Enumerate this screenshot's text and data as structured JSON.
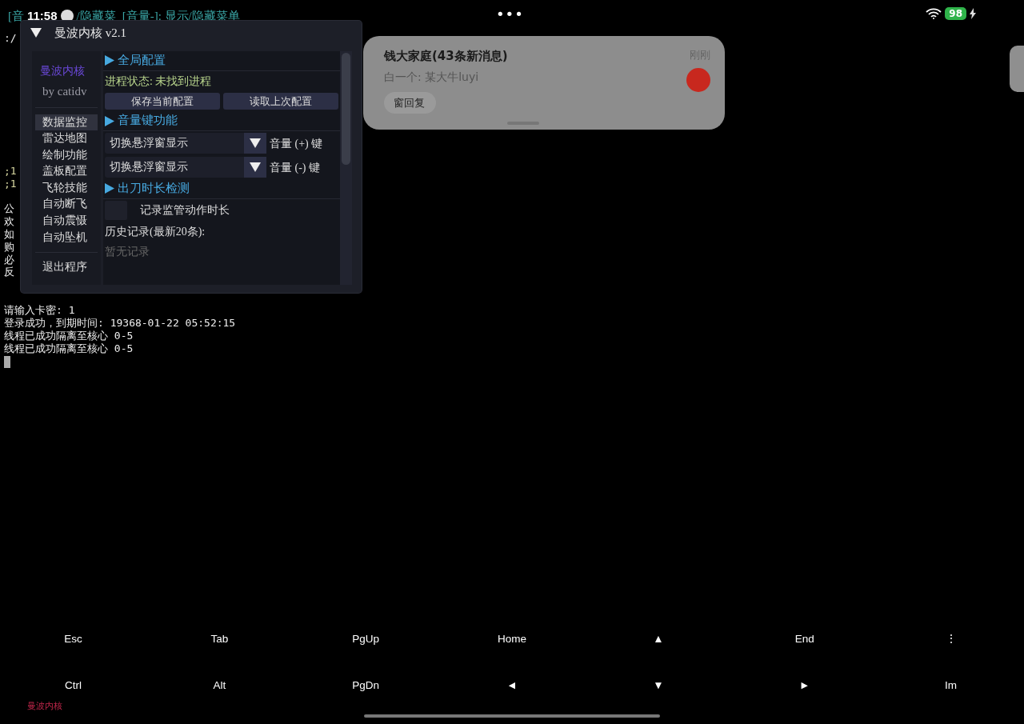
{
  "status_bar": {
    "time": "11:58",
    "battery": "98",
    "charging": true,
    "center_dots": "•••"
  },
  "terminal": {
    "header": [
      "[音",
      "/隐藏菜",
      "[音量-]: 显示/隐藏菜单"
    ],
    "groups": [
      [
        ":/"
      ],
      [
        ";1",
        ";1"
      ],
      [
        "公",
        "欢",
        "如",
        "购",
        "必",
        "反"
      ],
      [
        "请输入卡密: 1",
        "登录成功，到期时间: 19368-01-22 05:52:15",
        "线程已成功隔离至核心 0-5",
        "线程已成功隔离至核心 0-5"
      ]
    ]
  },
  "menu": {
    "title": "曼波内核 v2.1",
    "expanded": true,
    "sidebar": {
      "brand": "曼波内核",
      "author": "by catidv",
      "items": [
        {
          "label": "数据监控",
          "selected": true
        },
        {
          "label": "雷达地图",
          "selected": false
        },
        {
          "label": "绘制功能",
          "selected": false
        },
        {
          "label": "盖板配置",
          "selected": false
        },
        {
          "label": "飞轮技能",
          "selected": false
        },
        {
          "label": "自动断飞",
          "selected": false
        },
        {
          "label": "自动震慑",
          "selected": false
        },
        {
          "label": "自动坠机",
          "selected": false
        }
      ],
      "exit": "退出程序"
    },
    "sections": [
      {
        "header": "全局配置",
        "rows": [
          {
            "kind": "status",
            "label": "进程状态: ",
            "value": "未找到进程"
          },
          {
            "kind": "buttons",
            "buttons": [
              "保存当前配置",
              "读取上次配置"
            ]
          }
        ]
      },
      {
        "header": "音量键功能",
        "rows": [
          {
            "kind": "combo",
            "value": "切换悬浮窗显示",
            "label": "音量 (+) 键"
          },
          {
            "kind": "combo",
            "value": "切换悬浮窗显示",
            "label": "音量 (-) 键"
          }
        ]
      },
      {
        "header": "出刀时长检测",
        "rows": [
          {
            "kind": "checkbox",
            "label": "记录监管动作时长",
            "checked": false
          },
          {
            "kind": "text",
            "label": "历史记录(最新20条):"
          },
          {
            "kind": "muted",
            "label": "暂无记录"
          }
        ]
      }
    ]
  },
  "notification": {
    "title": "钱大家庭(43条新消息)",
    "body": "白一个: 某大牛luyi",
    "time": "刚刚",
    "action": "窗回复"
  },
  "extra_keys": [
    [
      "Esc",
      "Tab",
      "PgUp",
      "Home",
      "▲",
      "End",
      "⋮"
    ],
    [
      "Ctrl",
      "Alt",
      "PgDn",
      "◄",
      "▼",
      "►",
      "Im"
    ]
  ],
  "overlay_label": "曼波内核"
}
